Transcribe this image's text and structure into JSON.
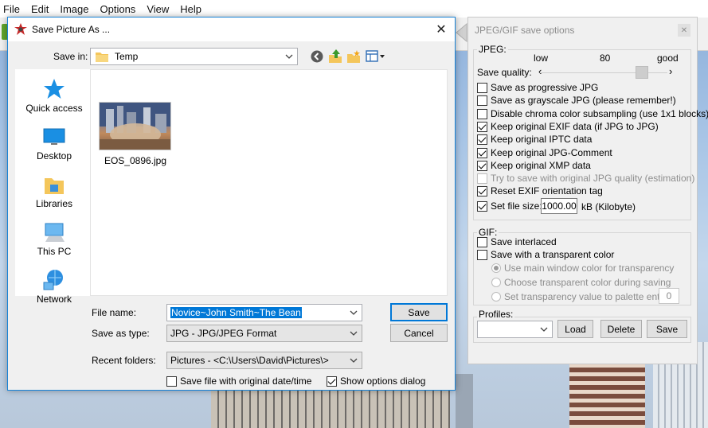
{
  "app": {
    "menu": [
      "File",
      "Edit",
      "Image",
      "Options",
      "View",
      "Help"
    ]
  },
  "save_dialog": {
    "title": "Save Picture As ...",
    "save_in_label": "Save in:",
    "save_in_value": "Temp",
    "places": [
      "Quick access",
      "Desktop",
      "Libraries",
      "This PC",
      "Network"
    ],
    "files": [
      {
        "name": "EOS_0896.jpg"
      }
    ],
    "file_name_label": "File name:",
    "file_name_value": "Novice~John Smith~The Bean",
    "save_as_type_label": "Save as type:",
    "save_as_type_value": "JPG - JPG/JPEG Format",
    "recent_folders_label": "Recent folders:",
    "recent_folders_value": "Pictures  -  <C:\\Users\\David\\Pictures\\>",
    "save_button": "Save",
    "cancel_button": "Cancel",
    "save_original_date_label": "Save file with original date/time",
    "save_original_date_checked": false,
    "show_options_label": "Show options dialog",
    "show_options_checked": true
  },
  "options_panel": {
    "title": "JPEG/GIF save options",
    "jpeg_group": "JPEG:",
    "quality_low": "low",
    "quality_value": "80",
    "quality_good": "good",
    "quality_label": "Save quality:",
    "quality_level": 80,
    "jpeg_options": [
      {
        "label": "Save as progressive JPG",
        "checked": false,
        "enabled": true
      },
      {
        "label": "Save as grayscale JPG (please remember!)",
        "checked": false,
        "enabled": true
      },
      {
        "label": "Disable chroma color subsampling (use 1x1 blocks)",
        "checked": false,
        "enabled": true
      },
      {
        "label": "Keep original EXIF data (if JPG to JPG)",
        "checked": true,
        "enabled": true
      },
      {
        "label": "Keep original IPTC data",
        "checked": true,
        "enabled": true
      },
      {
        "label": "Keep original JPG-Comment",
        "checked": true,
        "enabled": true
      },
      {
        "label": "Keep original XMP data",
        "checked": true,
        "enabled": true
      },
      {
        "label": "Try to save with original JPG quality (estimation)",
        "checked": false,
        "enabled": false
      },
      {
        "label": "Reset EXIF orientation tag",
        "checked": true,
        "enabled": true
      }
    ],
    "set_file_size_label": "Set file size:",
    "set_file_size_checked": true,
    "file_size_value": "1000.00",
    "file_size_unit": "kB (Kilobyte)",
    "gif_group": "GIF:",
    "gif_options": [
      {
        "label": "Save interlaced",
        "checked": false
      },
      {
        "label": "Save with a transparent color",
        "checked": false
      }
    ],
    "gif_radios": [
      {
        "label": "Use main window color for transparency",
        "selected": true
      },
      {
        "label": "Choose transparent color during saving",
        "selected": false
      },
      {
        "label": "Set transparency value to palette entry:",
        "selected": false
      }
    ],
    "palette_entry_value": "0",
    "profiles_group": "Profiles:",
    "profiles_value": "",
    "load_button": "Load",
    "delete_button": "Delete",
    "save_button": "Save"
  }
}
